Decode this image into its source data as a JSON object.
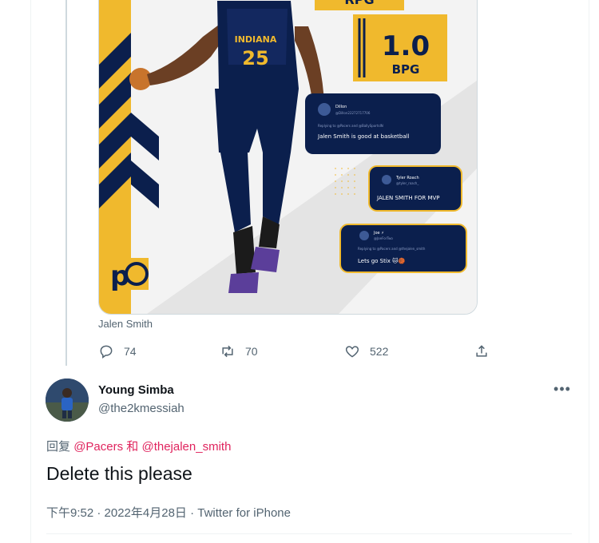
{
  "media": {
    "stat_rpg": "RPG",
    "stat_bpg_value": "1.0",
    "stat_bpg_label": "BPG",
    "jersey_team": "INDIANA",
    "jersey_number": "25",
    "bubbles": [
      {
        "name": "Dillon",
        "handle": "@Dillon22272717706",
        "replying": "Replying to @Pacers and @BallySportsIN",
        "text": "Jalen Smith is good at basketball"
      },
      {
        "name": "Tyler Roach",
        "handle": "@tyler_roach_",
        "replying": "",
        "text": "JALEN SMITH FOR MVP"
      },
      {
        "name": "Joe ⚡",
        "handle": "@JoeForTwo",
        "replying": "Replying to @Pacers and @thejalen_smith",
        "text": "Lets go Stix 🐱🏀"
      }
    ]
  },
  "caption": "Jalen Smith",
  "actions": {
    "reply_count": "74",
    "retweet_count": "70",
    "like_count": "522"
  },
  "reply": {
    "display_name": "Young Simba",
    "handle": "@the2kmessiah",
    "reply_prefix": "回复",
    "mention_1": "@Pacers",
    "conjunction": "和",
    "mention_2": "@thejalen_smith",
    "text": "Delete this please",
    "timestamp": "下午9:52 · 2022年4月28日 · Twitter for iPhone",
    "more_label": "•••"
  },
  "colors": {
    "pacers_navy": "#0b1f4d",
    "pacers_gold": "#f0b92d",
    "secondary_text": "#536471",
    "mention": "#e0245e"
  }
}
